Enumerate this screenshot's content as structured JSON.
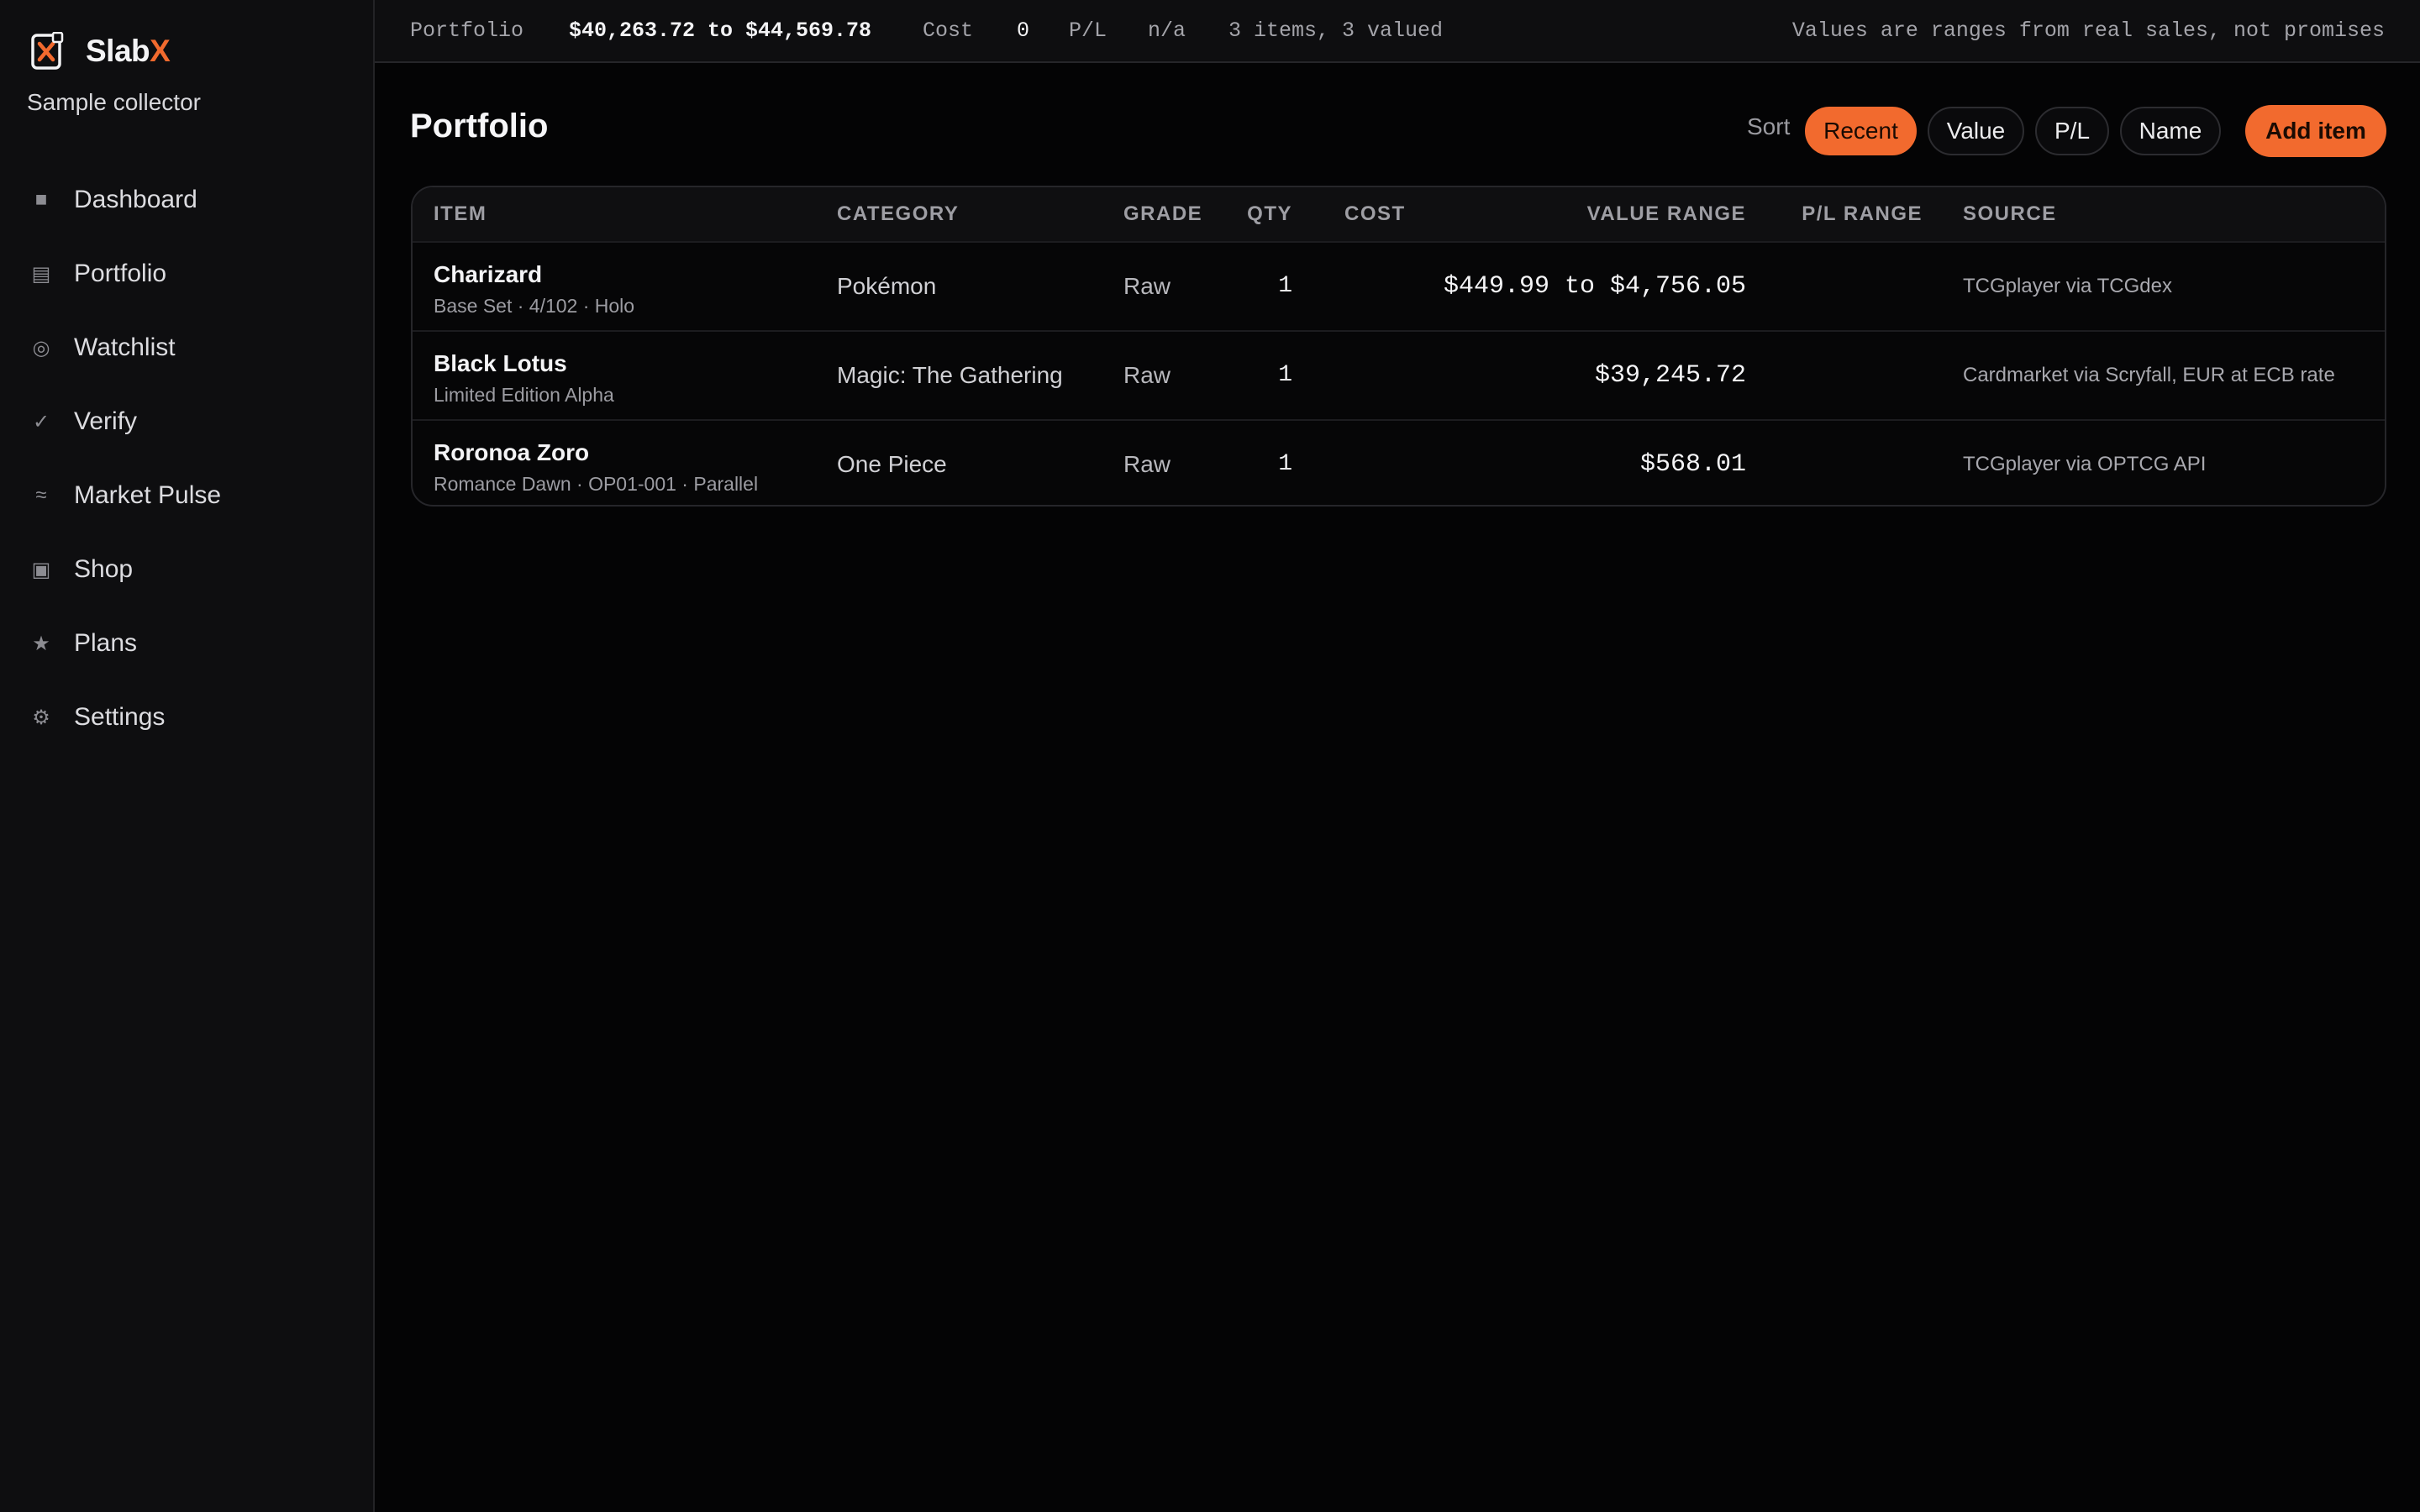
{
  "brand": {
    "name_main": "Slab",
    "name_accent": "X",
    "accent_color": "#f26a2e",
    "icon": "slabx-logo-icon"
  },
  "profile": {
    "name": "Sample collector"
  },
  "sidebar": {
    "items": [
      {
        "label": "Dashboard",
        "icon": "■"
      },
      {
        "label": "Portfolio",
        "icon": "▤"
      },
      {
        "label": "Watchlist",
        "icon": "◎"
      },
      {
        "label": "Verify",
        "icon": "✓"
      },
      {
        "label": "Market Pulse",
        "icon": "≈"
      },
      {
        "label": "Shop",
        "icon": "▣"
      },
      {
        "label": "Plans",
        "icon": "★"
      },
      {
        "label": "Settings",
        "icon": "⚙"
      }
    ]
  },
  "topbar": {
    "portfolio_label": "Portfolio",
    "portfolio_value": "$40,263.72 to $44,569.78",
    "cost_label": "Cost",
    "cost_value": "0",
    "pl_label": "P/L",
    "pl_value": "n/a",
    "items_summary": "3 items, 3 valued",
    "note": "Values are ranges from real sales, not promises"
  },
  "page": {
    "title": "Portfolio"
  },
  "sort": {
    "label": "Sort",
    "options": [
      "Recent",
      "Value",
      "P/L",
      "Name"
    ],
    "selected": "Recent"
  },
  "actions": {
    "add_item": "Add item"
  },
  "table": {
    "columns": {
      "item": "ITEM",
      "category": "CATEGORY",
      "grade": "GRADE",
      "qty": "QTY",
      "cost": "COST",
      "value_range": "VALUE RANGE",
      "pl_range": "P/L RANGE",
      "source": "SOURCE"
    },
    "rows": [
      {
        "name": "Charizard",
        "detail": "Base Set · 4/102 · Holo",
        "category": "Pokémon",
        "grade": "Raw",
        "qty": "1",
        "cost": "",
        "value_range": "$449.99 to $4,756.05",
        "pl_range": "",
        "source": "TCGplayer via TCGdex"
      },
      {
        "name": "Black Lotus",
        "detail": "Limited Edition Alpha",
        "category": "Magic: The Gathering",
        "grade": "Raw",
        "qty": "1",
        "cost": "",
        "value_range": "$39,245.72",
        "pl_range": "",
        "source": "Cardmarket via Scryfall, EUR at ECB rate"
      },
      {
        "name": "Roronoa Zoro",
        "detail": "Romance Dawn · OP01-001 · Parallel",
        "category": "One Piece",
        "grade": "Raw",
        "qty": "1",
        "cost": "",
        "value_range": "$568.01",
        "pl_range": "",
        "source": "TCGplayer via OPTCG API"
      }
    ]
  }
}
